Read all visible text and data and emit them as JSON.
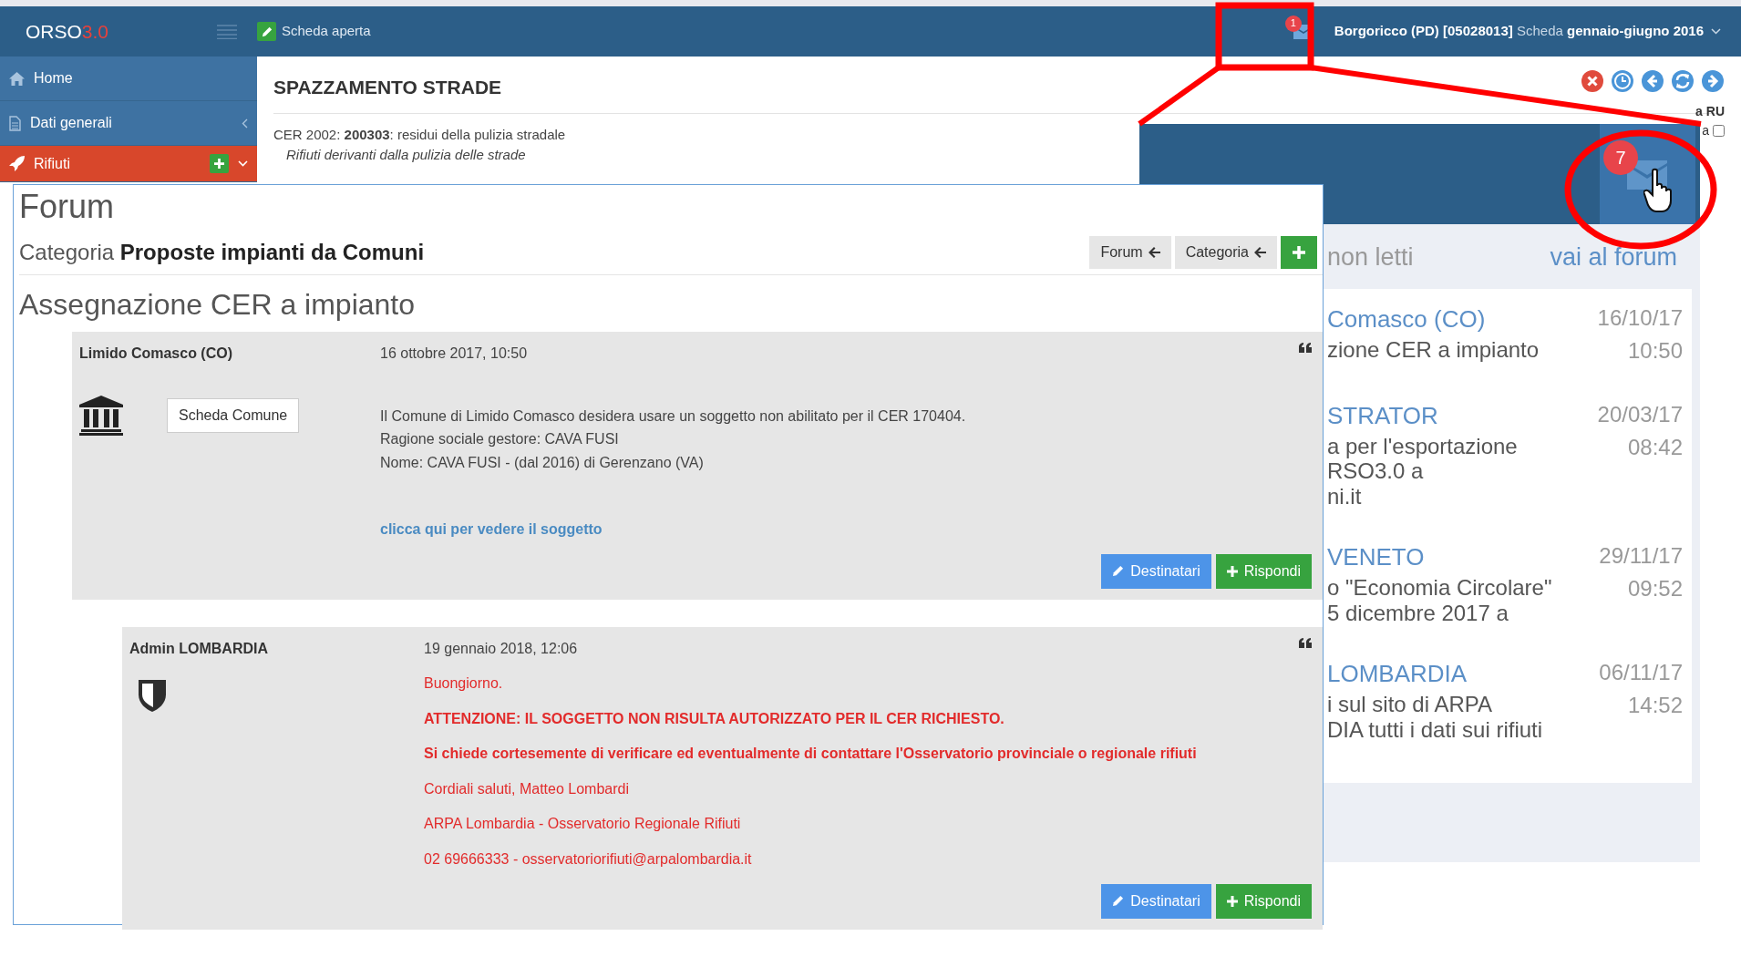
{
  "app": {
    "logo": "ORSO",
    "logo_version": "3.0",
    "open_tab": "Scheda aperta",
    "notification_count": "1",
    "location": "Borgoricco (PD) [05028013]",
    "scheda_label": "Scheda",
    "period": "gennaio-giugno 2016"
  },
  "sidebar": {
    "items": [
      {
        "label": "Home",
        "kind": "home",
        "selected": false
      },
      {
        "label": "Dati generali",
        "kind": "submenu",
        "selected": false
      },
      {
        "label": "Rifiuti",
        "kind": "add",
        "selected": true
      }
    ]
  },
  "page": {
    "title": "SPAZZAMENTO STRADE",
    "cer_line": "CER 2002: **200303**: residui della pulizia stradale",
    "description": "Rifiuti derivanti dalla pulizia delle strade",
    "side_label": "a RU",
    "side_option": {
      "label": "a",
      "checked": false
    }
  },
  "forum": {
    "title": "Forum",
    "category_label": "Categoria",
    "category": "Proposte impianti da Comuni",
    "nav_buttons": [
      {
        "label": "Forum",
        "kind": "back"
      },
      {
        "label": "Categoria",
        "kind": "back"
      },
      {
        "kind": "add"
      }
    ],
    "topic": "Assegnazione CER a impianto",
    "posts": [
      {
        "author": "Limido Comasco (CO)",
        "date": "16 ottobre 2017, 10:50",
        "kind": "municipality",
        "profile_button": "Scheda Comune",
        "indent": false,
        "lines": [
          {
            "text": "Il Comune di Limido Comasco desidera usare un soggetto non abilitato per il CER 170404.",
            "kind": "plain"
          },
          {
            "text": "Ragione sociale gestore: CAVA FUSI",
            "kind": "plain"
          },
          {
            "text": "Nome: CAVA FUSI - (dal 2016) di Gerenzano (VA)",
            "kind": "plain"
          },
          {
            "text": "clicca qui per vedere il soggetto",
            "kind": "link"
          }
        ],
        "actions": [
          {
            "label": "Destinatari",
            "kind": "recipients"
          },
          {
            "label": "Rispondi",
            "kind": "reply"
          }
        ]
      },
      {
        "author": "Admin LOMBARDIA",
        "date": "19 gennaio 2018, 12:06",
        "kind": "admin",
        "indent": true,
        "lines": [
          {
            "text": "Buongiorno.",
            "kind": "alert"
          },
          {
            "text": "ATTENZIONE: IL SOGGETTO NON RISULTA AUTORIZZATO PER IL CER RICHIESTO.",
            "kind": "alert_strong"
          },
          {
            "text": "Si chiede cortesemente di verificare ed eventualmente di contattare l'Osservatorio provinciale o regionale rifiuti",
            "kind": "alert_strong"
          },
          {
            "text": "Cordiali saluti, Matteo Lombardi",
            "kind": "alert"
          },
          {
            "text": "ARPA Lombardia - Osservatorio Regionale Rifiuti",
            "kind": "alert"
          },
          {
            "text": "02 69666333 - osservatoriorifiuti@arpalombardia.it",
            "kind": "alert"
          }
        ],
        "actions": [
          {
            "label": "Destinatari",
            "kind": "recipients"
          },
          {
            "label": "Rispondi",
            "kind": "reply"
          }
        ]
      }
    ]
  },
  "notifications_zoom": {
    "badge": "7",
    "unread_label": "non letti",
    "forum_link": "vai al forum",
    "items": [
      {
        "author": "Comasco (CO)",
        "subject_lines": [
          "zione CER a impianto"
        ],
        "date": "16/10/17",
        "time": "10:50"
      },
      {
        "author": "STRATOR",
        "subject_lines": [
          "a per l'esportazione",
          "RSO3.0 a",
          "ni.it"
        ],
        "date": "20/03/17",
        "time": "08:42"
      },
      {
        "author": "VENETO",
        "subject_lines": [
          "o \"Economia Circolare\"",
          "5 dicembre 2017 a"
        ],
        "date": "29/11/17",
        "time": "09:52"
      },
      {
        "author": "LOMBARDIA",
        "subject_lines": [
          "i sul sito di ARPA",
          "DIA tutti i dati sui rifiuti"
        ],
        "date": "06/11/17",
        "time": "14:52"
      }
    ]
  }
}
